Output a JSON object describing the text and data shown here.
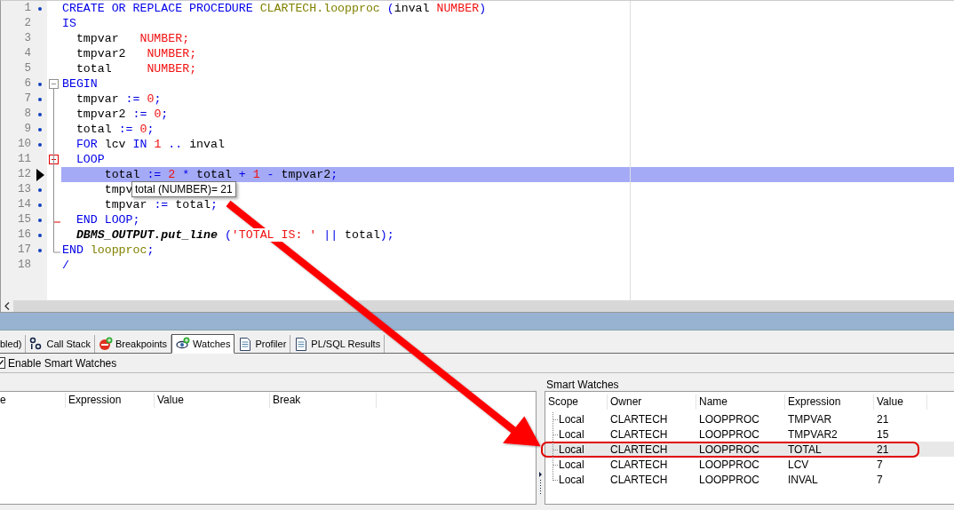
{
  "editor": {
    "lines": [
      {
        "number": "1",
        "executable": true,
        "tokens": [
          {
            "kind": "keyword",
            "text": "CREATE OR REPLACE PROCEDURE "
          },
          {
            "kind": "name",
            "text": "CLARTECH.loopproc"
          },
          {
            "kind": "operator",
            "text": " ("
          },
          {
            "kind": "ident",
            "text": "inval "
          },
          {
            "kind": "type",
            "text": "NUMBER"
          },
          {
            "kind": "operator",
            "text": ")"
          }
        ]
      },
      {
        "number": "2",
        "executable": false,
        "tokens": [
          {
            "kind": "keyword",
            "text": "IS"
          }
        ]
      },
      {
        "number": "3",
        "executable": false,
        "tokens": [
          {
            "kind": "ident",
            "text": "  tmpvar   "
          },
          {
            "kind": "type",
            "text": "NUMBER;"
          }
        ]
      },
      {
        "number": "4",
        "executable": false,
        "tokens": [
          {
            "kind": "ident",
            "text": "  tmpvar2   "
          },
          {
            "kind": "type",
            "text": "NUMBER;"
          }
        ]
      },
      {
        "number": "5",
        "executable": false,
        "tokens": [
          {
            "kind": "ident",
            "text": "  total     "
          },
          {
            "kind": "type",
            "text": "NUMBER;"
          }
        ]
      },
      {
        "number": "6",
        "executable": true,
        "fold_start": true,
        "active": false,
        "tokens": [
          {
            "kind": "keyword",
            "text": "BEGIN"
          }
        ]
      },
      {
        "number": "7",
        "executable": true,
        "tokens": [
          {
            "kind": "ident",
            "text": "  tmpvar "
          },
          {
            "kind": "operator",
            "text": ":= "
          },
          {
            "kind": "number",
            "text": "0"
          },
          {
            "kind": "operator",
            "text": ";"
          }
        ]
      },
      {
        "number": "8",
        "executable": true,
        "tokens": [
          {
            "kind": "ident",
            "text": "  tmpvar2 "
          },
          {
            "kind": "operator",
            "text": ":= "
          },
          {
            "kind": "number",
            "text": "0"
          },
          {
            "kind": "operator",
            "text": ";"
          }
        ]
      },
      {
        "number": "9",
        "executable": true,
        "tokens": [
          {
            "kind": "ident",
            "text": "  total "
          },
          {
            "kind": "operator",
            "text": ":= "
          },
          {
            "kind": "number",
            "text": "0"
          },
          {
            "kind": "operator",
            "text": ";"
          }
        ]
      },
      {
        "number": "10",
        "executable": true,
        "tokens": [
          {
            "kind": "keyword",
            "text": "  FOR "
          },
          {
            "kind": "ident",
            "text": "lcv "
          },
          {
            "kind": "keyword",
            "text": "IN "
          },
          {
            "kind": "number",
            "text": "1"
          },
          {
            "kind": "operator",
            "text": " .. "
          },
          {
            "kind": "ident",
            "text": "inval"
          }
        ]
      },
      {
        "number": "11",
        "executable": false,
        "fold_start": true,
        "active": true,
        "tokens": [
          {
            "kind": "keyword",
            "text": "  LOOP"
          }
        ]
      },
      {
        "number": "12",
        "executable": false,
        "current": true,
        "tokens": [
          {
            "kind": "ident",
            "text": "      total "
          },
          {
            "kind": "operator",
            "text": ":= "
          },
          {
            "kind": "number",
            "text": "2"
          },
          {
            "kind": "operator",
            "text": " * "
          },
          {
            "kind": "ident",
            "text": "total "
          },
          {
            "kind": "operator",
            "text": "+ "
          },
          {
            "kind": "number",
            "text": "1"
          },
          {
            "kind": "operator",
            "text": " - "
          },
          {
            "kind": "ident",
            "text": "tmpvar2"
          },
          {
            "kind": "operator",
            "text": ";"
          }
        ]
      },
      {
        "number": "13",
        "executable": true,
        "tokens": [
          {
            "kind": "ident",
            "text": "      tmpv"
          }
        ]
      },
      {
        "number": "14",
        "executable": true,
        "tokens": [
          {
            "kind": "ident",
            "text": "      tmpvar "
          },
          {
            "kind": "operator",
            "text": ":= "
          },
          {
            "kind": "ident",
            "text": "total"
          },
          {
            "kind": "operator",
            "text": ";"
          }
        ]
      },
      {
        "number": "15",
        "executable": true,
        "fold_end": true,
        "tokens": [
          {
            "kind": "keyword",
            "text": "  END LOOP;"
          }
        ]
      },
      {
        "number": "16",
        "executable": true,
        "tokens": [
          {
            "kind": "builtin",
            "text": "  DBMS_OUTPUT.put_line"
          },
          {
            "kind": "operator",
            "text": " ("
          },
          {
            "kind": "string",
            "text": "'TOTAL IS: '"
          },
          {
            "kind": "operator",
            "text": " || "
          },
          {
            "kind": "ident",
            "text": "total"
          },
          {
            "kind": "operator",
            "text": ");"
          }
        ]
      },
      {
        "number": "17",
        "executable": true,
        "fold_end": true,
        "tokens": [
          {
            "kind": "keyword",
            "text": "END "
          },
          {
            "kind": "name",
            "text": "loopproc"
          },
          {
            "kind": "operator",
            "text": ";"
          }
        ]
      },
      {
        "number": "18",
        "executable": false,
        "tokens": [
          {
            "kind": "operator",
            "text": "/"
          }
        ]
      }
    ],
    "tooltip": "total (NUMBER)= 21"
  },
  "tabs": [
    {
      "label": "bled)",
      "selected": false,
      "kind": "plain"
    },
    {
      "label": "Call Stack",
      "selected": false,
      "kind": "stack"
    },
    {
      "label": "Breakpoints",
      "selected": false,
      "kind": "breakpoint"
    },
    {
      "label": "Watches",
      "selected": true,
      "kind": "eye"
    },
    {
      "label": "Profiler",
      "selected": false,
      "kind": "page"
    },
    {
      "label": "PL/SQL Results",
      "selected": false,
      "kind": "page"
    }
  ],
  "smart_watches_toggle": {
    "label": "Enable Smart Watches",
    "checked": true
  },
  "watches": {
    "columns": [
      "e",
      "Expression",
      "Value",
      "Break"
    ]
  },
  "smart_watches": {
    "title": "Smart Watches",
    "columns": [
      "Scope",
      "Owner",
      "Name",
      "Expression",
      "Value"
    ],
    "rows": [
      {
        "scope": "Local",
        "owner": "CLARTECH",
        "name": "LOOPPROC",
        "expression": "TMPVAR",
        "value": "21",
        "selected": false
      },
      {
        "scope": "Local",
        "owner": "CLARTECH",
        "name": "LOOPPROC",
        "expression": "TMPVAR2",
        "value": "15",
        "selected": false
      },
      {
        "scope": "Local",
        "owner": "CLARTECH",
        "name": "LOOPPROC",
        "expression": "TOTAL",
        "value": "21",
        "selected": true
      },
      {
        "scope": "Local",
        "owner": "CLARTECH",
        "name": "LOOPPROC",
        "expression": "LCV",
        "value": "7",
        "selected": false
      },
      {
        "scope": "Local",
        "owner": "CLARTECH",
        "name": "LOOPPROC",
        "expression": "INVAL",
        "value": "7",
        "selected": false
      }
    ]
  }
}
